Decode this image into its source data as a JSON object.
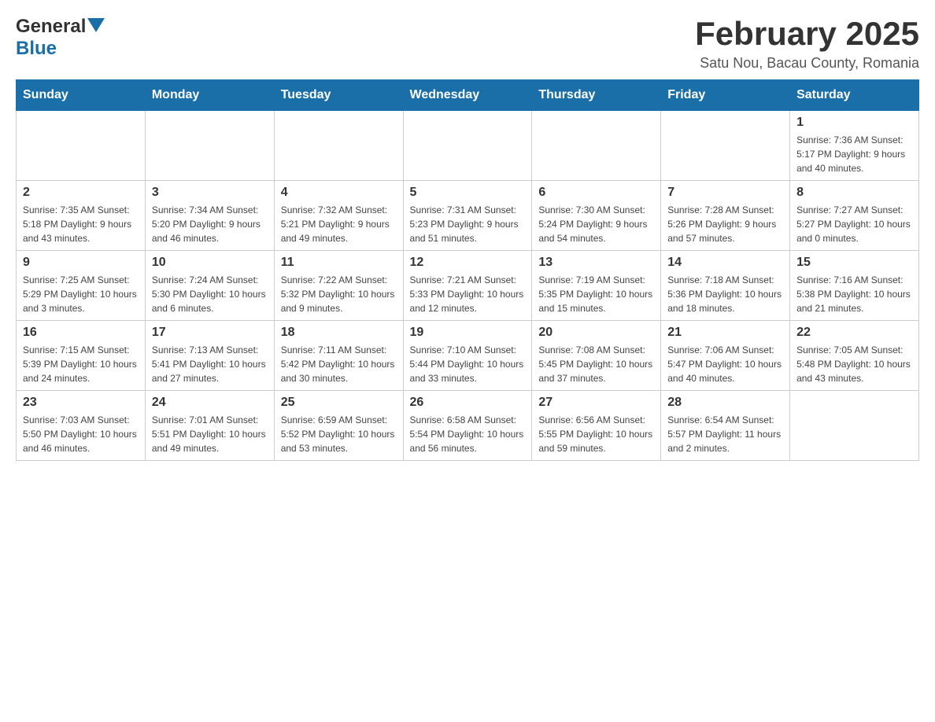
{
  "header": {
    "logo": {
      "general": "General",
      "blue": "Blue"
    },
    "title": "February 2025",
    "location": "Satu Nou, Bacau County, Romania"
  },
  "days_of_week": [
    "Sunday",
    "Monday",
    "Tuesday",
    "Wednesday",
    "Thursday",
    "Friday",
    "Saturday"
  ],
  "weeks": [
    [
      {
        "day": "",
        "info": ""
      },
      {
        "day": "",
        "info": ""
      },
      {
        "day": "",
        "info": ""
      },
      {
        "day": "",
        "info": ""
      },
      {
        "day": "",
        "info": ""
      },
      {
        "day": "",
        "info": ""
      },
      {
        "day": "1",
        "info": "Sunrise: 7:36 AM\nSunset: 5:17 PM\nDaylight: 9 hours and 40 minutes."
      }
    ],
    [
      {
        "day": "2",
        "info": "Sunrise: 7:35 AM\nSunset: 5:18 PM\nDaylight: 9 hours and 43 minutes."
      },
      {
        "day": "3",
        "info": "Sunrise: 7:34 AM\nSunset: 5:20 PM\nDaylight: 9 hours and 46 minutes."
      },
      {
        "day": "4",
        "info": "Sunrise: 7:32 AM\nSunset: 5:21 PM\nDaylight: 9 hours and 49 minutes."
      },
      {
        "day": "5",
        "info": "Sunrise: 7:31 AM\nSunset: 5:23 PM\nDaylight: 9 hours and 51 minutes."
      },
      {
        "day": "6",
        "info": "Sunrise: 7:30 AM\nSunset: 5:24 PM\nDaylight: 9 hours and 54 minutes."
      },
      {
        "day": "7",
        "info": "Sunrise: 7:28 AM\nSunset: 5:26 PM\nDaylight: 9 hours and 57 minutes."
      },
      {
        "day": "8",
        "info": "Sunrise: 7:27 AM\nSunset: 5:27 PM\nDaylight: 10 hours and 0 minutes."
      }
    ],
    [
      {
        "day": "9",
        "info": "Sunrise: 7:25 AM\nSunset: 5:29 PM\nDaylight: 10 hours and 3 minutes."
      },
      {
        "day": "10",
        "info": "Sunrise: 7:24 AM\nSunset: 5:30 PM\nDaylight: 10 hours and 6 minutes."
      },
      {
        "day": "11",
        "info": "Sunrise: 7:22 AM\nSunset: 5:32 PM\nDaylight: 10 hours and 9 minutes."
      },
      {
        "day": "12",
        "info": "Sunrise: 7:21 AM\nSunset: 5:33 PM\nDaylight: 10 hours and 12 minutes."
      },
      {
        "day": "13",
        "info": "Sunrise: 7:19 AM\nSunset: 5:35 PM\nDaylight: 10 hours and 15 minutes."
      },
      {
        "day": "14",
        "info": "Sunrise: 7:18 AM\nSunset: 5:36 PM\nDaylight: 10 hours and 18 minutes."
      },
      {
        "day": "15",
        "info": "Sunrise: 7:16 AM\nSunset: 5:38 PM\nDaylight: 10 hours and 21 minutes."
      }
    ],
    [
      {
        "day": "16",
        "info": "Sunrise: 7:15 AM\nSunset: 5:39 PM\nDaylight: 10 hours and 24 minutes."
      },
      {
        "day": "17",
        "info": "Sunrise: 7:13 AM\nSunset: 5:41 PM\nDaylight: 10 hours and 27 minutes."
      },
      {
        "day": "18",
        "info": "Sunrise: 7:11 AM\nSunset: 5:42 PM\nDaylight: 10 hours and 30 minutes."
      },
      {
        "day": "19",
        "info": "Sunrise: 7:10 AM\nSunset: 5:44 PM\nDaylight: 10 hours and 33 minutes."
      },
      {
        "day": "20",
        "info": "Sunrise: 7:08 AM\nSunset: 5:45 PM\nDaylight: 10 hours and 37 minutes."
      },
      {
        "day": "21",
        "info": "Sunrise: 7:06 AM\nSunset: 5:47 PM\nDaylight: 10 hours and 40 minutes."
      },
      {
        "day": "22",
        "info": "Sunrise: 7:05 AM\nSunset: 5:48 PM\nDaylight: 10 hours and 43 minutes."
      }
    ],
    [
      {
        "day": "23",
        "info": "Sunrise: 7:03 AM\nSunset: 5:50 PM\nDaylight: 10 hours and 46 minutes."
      },
      {
        "day": "24",
        "info": "Sunrise: 7:01 AM\nSunset: 5:51 PM\nDaylight: 10 hours and 49 minutes."
      },
      {
        "day": "25",
        "info": "Sunrise: 6:59 AM\nSunset: 5:52 PM\nDaylight: 10 hours and 53 minutes."
      },
      {
        "day": "26",
        "info": "Sunrise: 6:58 AM\nSunset: 5:54 PM\nDaylight: 10 hours and 56 minutes."
      },
      {
        "day": "27",
        "info": "Sunrise: 6:56 AM\nSunset: 5:55 PM\nDaylight: 10 hours and 59 minutes."
      },
      {
        "day": "28",
        "info": "Sunrise: 6:54 AM\nSunset: 5:57 PM\nDaylight: 11 hours and 2 minutes."
      },
      {
        "day": "",
        "info": ""
      }
    ]
  ]
}
